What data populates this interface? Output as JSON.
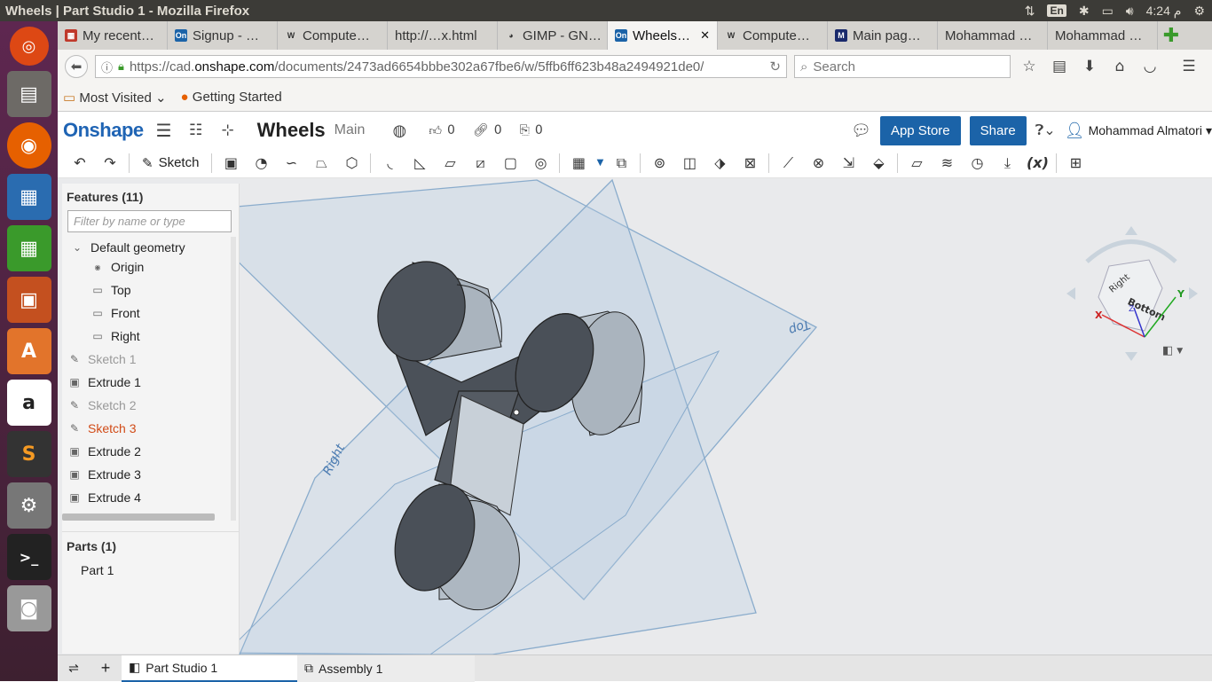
{
  "window": {
    "title": "Wheels | Part Studio 1 - Mozilla Firefox"
  },
  "tray": {
    "lang": "En",
    "time": "4:24 م"
  },
  "tabs": [
    {
      "label": "My recent…",
      "active": false,
      "icon": "bookmark-icon"
    },
    {
      "label": "Signup - …",
      "active": false,
      "icon": "onshape-icon"
    },
    {
      "label": "Compute…",
      "active": false,
      "icon": "wiki-icon"
    },
    {
      "label": "http://…x.html",
      "active": false,
      "icon": "page-icon"
    },
    {
      "label": "GIMP - GN…",
      "active": false,
      "icon": "gimp-icon"
    },
    {
      "label": "Wheels…",
      "active": true,
      "icon": "onshape-icon"
    },
    {
      "label": "Compute…",
      "active": false,
      "icon": "wiki-icon"
    },
    {
      "label": "Main pag…",
      "active": false,
      "icon": "mendeley-icon"
    },
    {
      "label": "Mohammad …",
      "active": false,
      "icon": "page-icon"
    },
    {
      "label": "Mohammad …",
      "active": false,
      "icon": "page-icon"
    }
  ],
  "nav": {
    "url_prefix": "https://cad.",
    "url_domain": "onshape.com",
    "url_path": "/documents/2473ad6654bbbe302a67fbe6/w/5ffb6ff623b48a2494921de0/",
    "search_placeholder": "Search"
  },
  "bookmarks": {
    "most_visited": "Most Visited",
    "getting_started": "Getting Started"
  },
  "onshape": {
    "logo": "Onshape",
    "doc_title": "Wheels",
    "workspace": "Main",
    "likes": "0",
    "links": "0",
    "copies": "0",
    "app_store": "App Store",
    "share": "Share",
    "user": "Mohammad Almatori"
  },
  "toolbar": {
    "sketch_label": "Sketch"
  },
  "features": {
    "header": "Features (11)",
    "filter_placeholder": "Filter by name or type",
    "items": [
      {
        "label": "Default geometry",
        "type": "group",
        "state": "normal"
      },
      {
        "label": "Origin",
        "type": "origin",
        "state": "normal"
      },
      {
        "label": "Top",
        "type": "plane",
        "state": "normal"
      },
      {
        "label": "Front",
        "type": "plane",
        "state": "normal"
      },
      {
        "label": "Right",
        "type": "plane",
        "state": "normal"
      },
      {
        "label": "Sketch 1",
        "type": "sketch",
        "state": "dim"
      },
      {
        "label": "Extrude 1",
        "type": "extrude",
        "state": "normal"
      },
      {
        "label": "Sketch 2",
        "type": "sketch",
        "state": "dim"
      },
      {
        "label": "Sketch 3",
        "type": "sketch",
        "state": "red"
      },
      {
        "label": "Extrude 2",
        "type": "extrude",
        "state": "normal"
      },
      {
        "label": "Extrude 3",
        "type": "extrude",
        "state": "normal"
      },
      {
        "label": "Extrude 4",
        "type": "extrude",
        "state": "normal"
      }
    ]
  },
  "parts": {
    "header": "Parts (1)",
    "items": [
      "Part 1"
    ]
  },
  "viewport": {
    "plane_top": "Top",
    "plane_right": "Right"
  },
  "viewcube": {
    "face_top": "Right",
    "face_front": "Bottom",
    "axis_x": "X",
    "axis_y": "Y",
    "axis_z": "Z"
  },
  "bottom_tabs": [
    {
      "label": "Part Studio 1",
      "active": true
    },
    {
      "label": "Assembly 1",
      "active": false
    }
  ],
  "colors": {
    "onshape_blue": "#1b63a8",
    "ubuntu_bar": "#3c3b37",
    "launcher": "#5e2750",
    "error_red": "#d14b17"
  }
}
